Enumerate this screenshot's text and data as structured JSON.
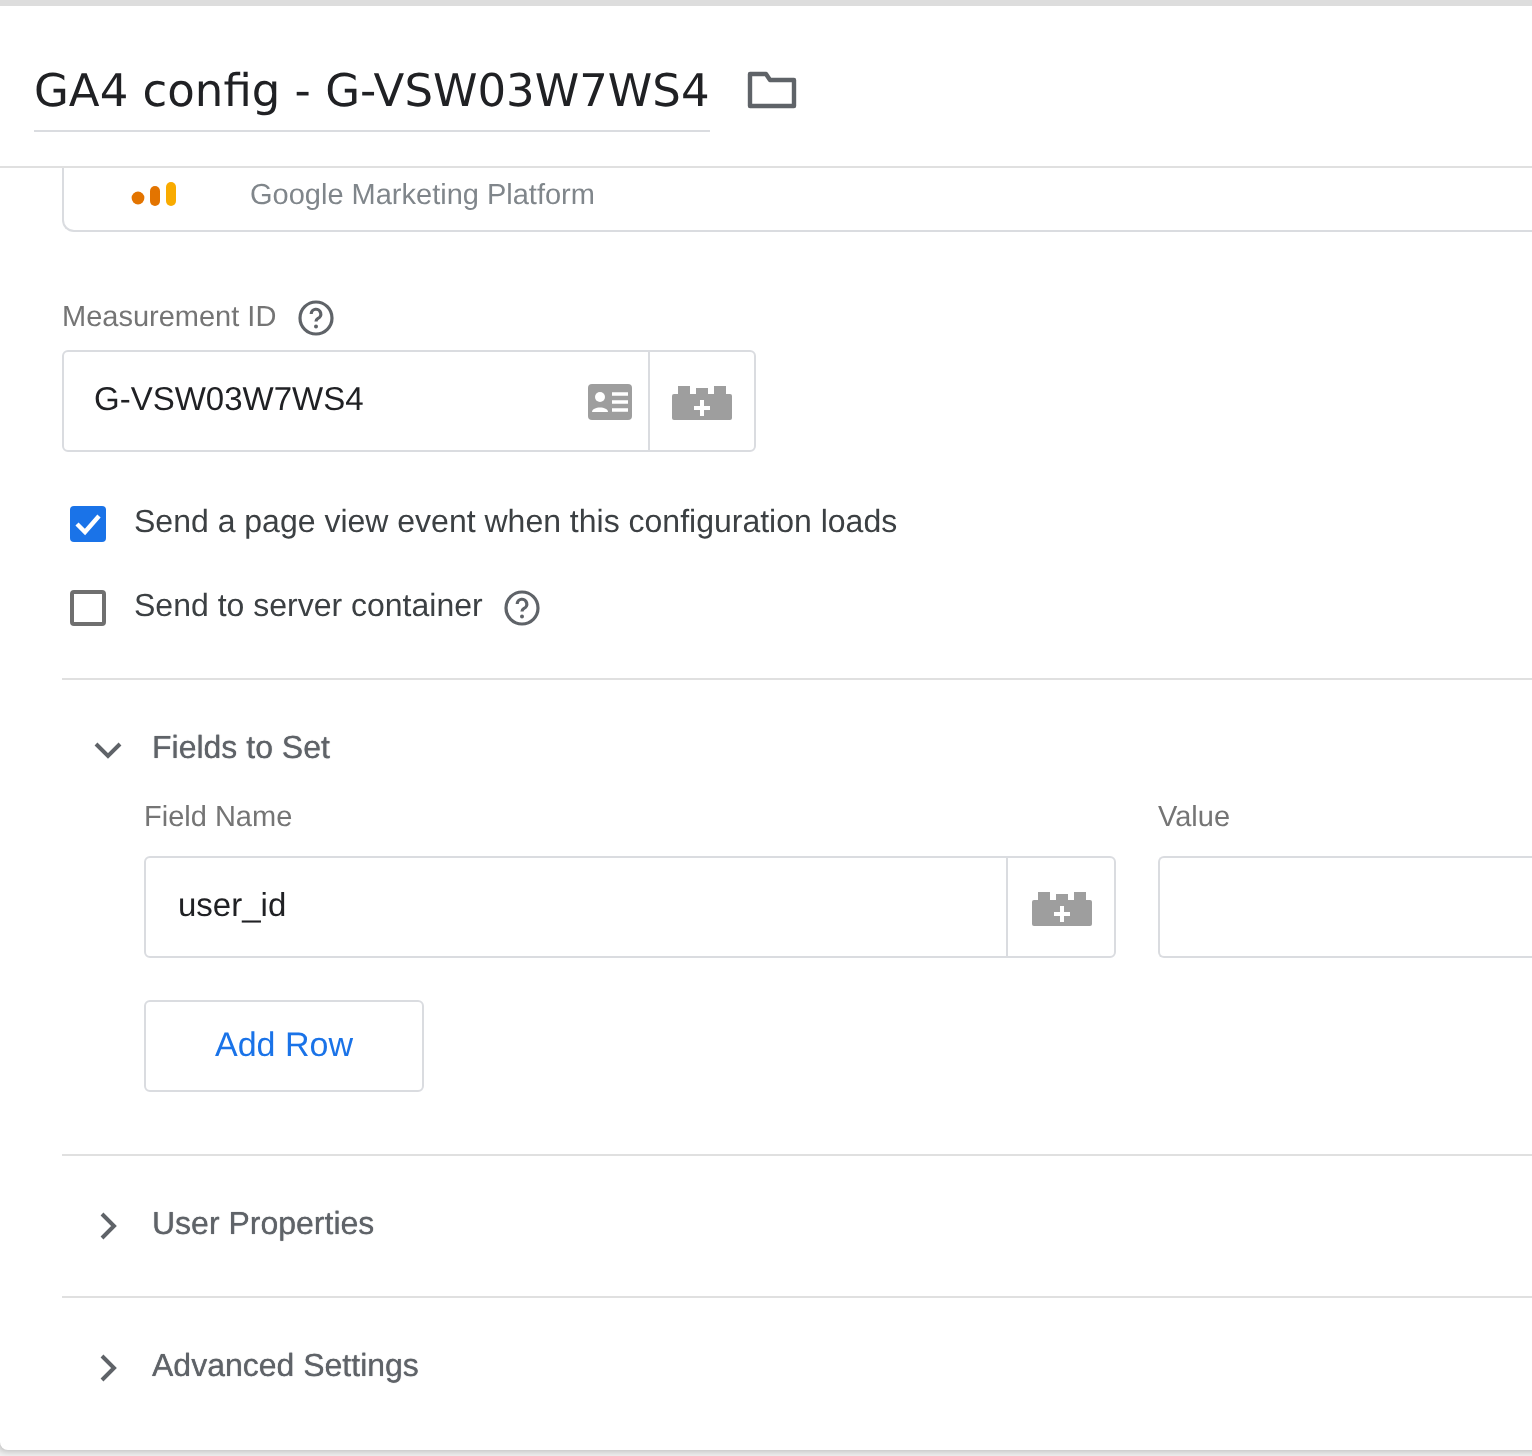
{
  "header": {
    "title": "GA4 config - G-VSW03W7WS4"
  },
  "tag_type": {
    "subtitle": "Google Marketing Platform"
  },
  "measurement_id": {
    "label": "Measurement ID",
    "value": "G-VSW03W7WS4"
  },
  "options": [
    {
      "label": "Send a page view event when this configuration loads",
      "checked": true,
      "help": false
    },
    {
      "label": "Send to server container",
      "checked": false,
      "help": true
    }
  ],
  "sections": [
    {
      "title": "Fields to Set",
      "expanded": true,
      "columns": [
        "Field Name",
        "Value"
      ],
      "rows": [
        {
          "field_name": "user_id",
          "value": ""
        }
      ],
      "add_button": "Add Row"
    },
    {
      "title": "User Properties",
      "expanded": false
    },
    {
      "title": "Advanced Settings",
      "expanded": false
    }
  ]
}
